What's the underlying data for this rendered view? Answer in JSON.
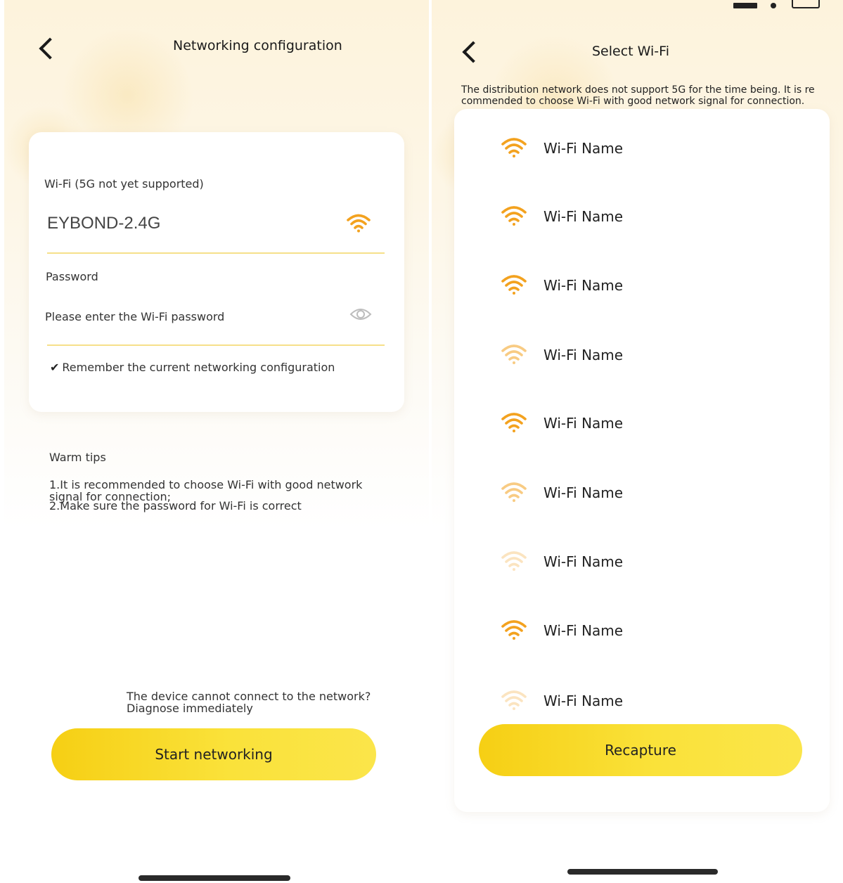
{
  "config_screen": {
    "title": "Networking configuration",
    "wifi_label": "Wi-Fi (5G not yet supported)",
    "wifi_value": "EYBOND-2.4G",
    "password_label": "Password",
    "password_placeholder": "Please enter the Wi-Fi password",
    "remember_check": "✔",
    "remember_label": "Remember the current networking configuration",
    "tips_title": "Warm tips",
    "tip_1": "1.It is recommended to choose Wi-Fi with good network signal for connection;",
    "tip_2": "2.Make sure the password for Wi-Fi is correct",
    "diagnose_text": "The device cannot connect to the network? Diagnose immediately",
    "start_button": "Start networking"
  },
  "select_screen": {
    "title": "Select Wi-Fi",
    "notice": "The distribution network does not support 5G for the time being. It is recommended to choose Wi-Fi with good network signal for connection.",
    "networks": [
      {
        "name": "Wi-Fi Name",
        "signal": "strong"
      },
      {
        "name": "Wi-Fi Name",
        "signal": "strong"
      },
      {
        "name": "Wi-Fi Name",
        "signal": "strong"
      },
      {
        "name": "Wi-Fi Name",
        "signal": "weak"
      },
      {
        "name": "Wi-Fi Name",
        "signal": "strong"
      },
      {
        "name": "Wi-Fi Name",
        "signal": "weak"
      },
      {
        "name": "Wi-Fi Name",
        "signal": "faint"
      },
      {
        "name": "Wi-Fi Name",
        "signal": "strong"
      },
      {
        "name": "Wi-Fi Name",
        "signal": "faint"
      }
    ],
    "recapture_button": "Recapture"
  },
  "colors": {
    "accent_orange": "#f3a21f",
    "button_yellow": "#f8d521",
    "underline": "#f6e08a"
  },
  "icons": [
    "back-arrow-icon",
    "wifi-signal-icon",
    "eye-icon",
    "checkmark-icon"
  ]
}
